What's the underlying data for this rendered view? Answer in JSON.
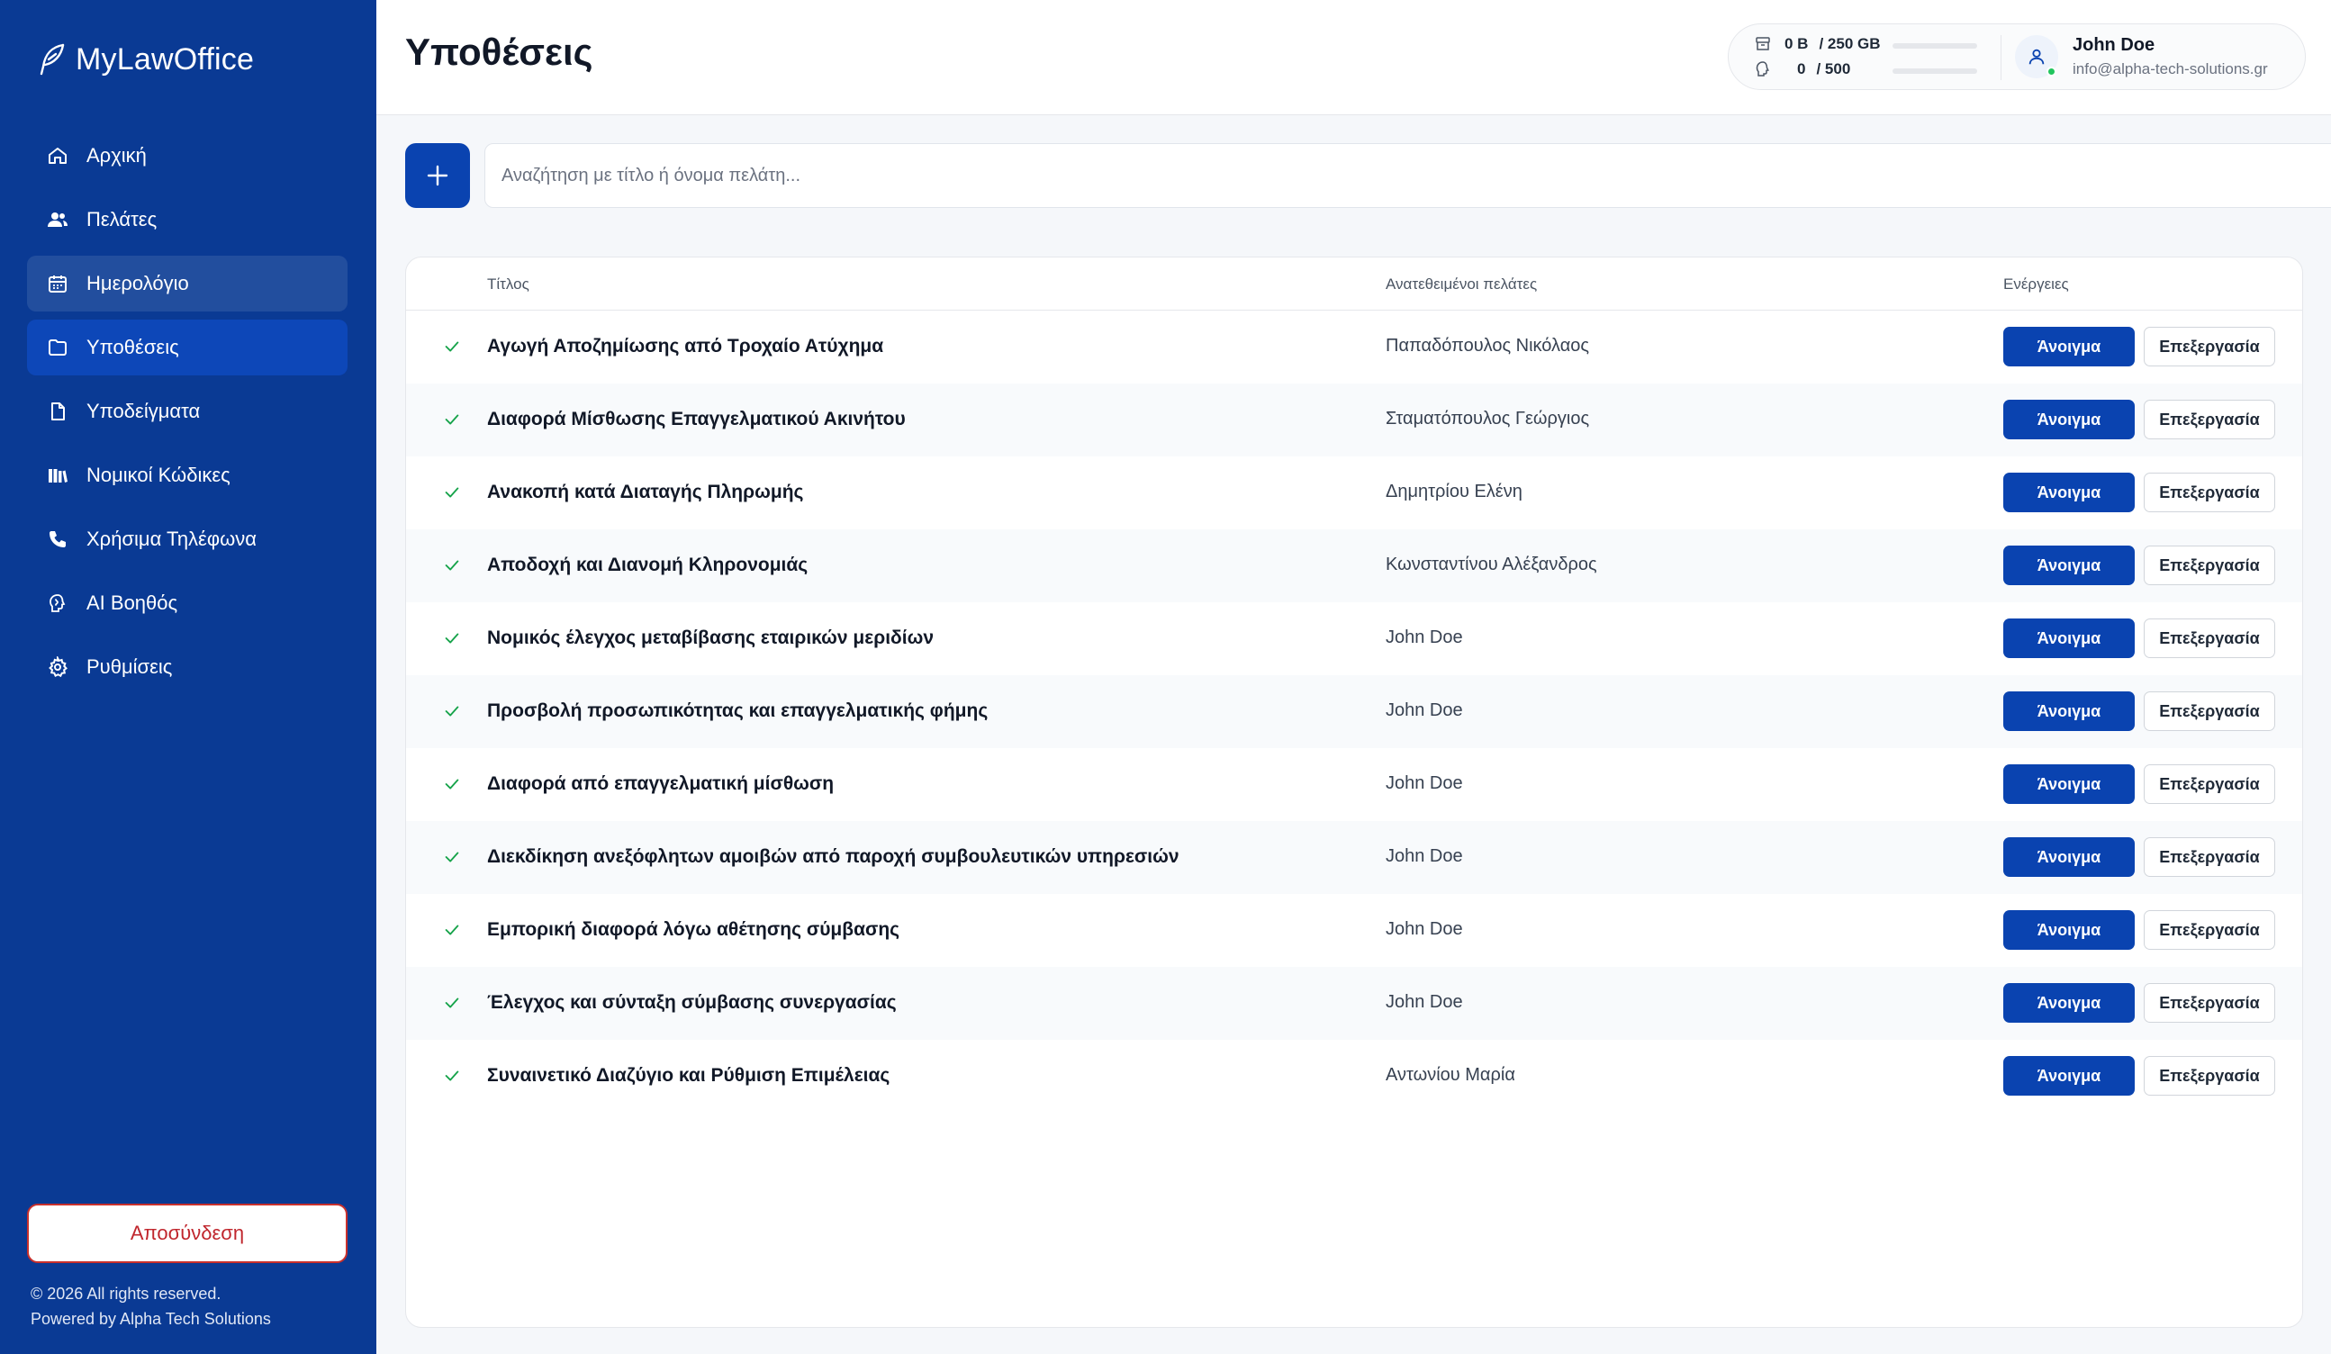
{
  "app": {
    "logo_text": "MyLawOffice"
  },
  "sidebar": {
    "items": [
      {
        "label": "Αρχική",
        "icon": "home-icon"
      },
      {
        "label": "Πελάτες",
        "icon": "users-icon"
      },
      {
        "label": "Ημερολόγιο",
        "icon": "calendar-icon"
      },
      {
        "label": "Υποθέσεις",
        "icon": "folder-icon"
      },
      {
        "label": "Υποδείγματα",
        "icon": "file-icon"
      },
      {
        "label": "Νομικοί Κώδικες",
        "icon": "library-icon"
      },
      {
        "label": "Χρήσιμα Τηλέφωνα",
        "icon": "phone-icon"
      },
      {
        "label": "AI Βοηθός",
        "icon": "brain-icon"
      },
      {
        "label": "Ρυθμίσεις",
        "icon": "gear-icon"
      }
    ],
    "active_item": "Υποθέσεις",
    "hover_item": "Ημερολόγιο",
    "logout_label": "Αποσύνδεση",
    "copyright": "© 2026 All rights reserved.",
    "powered_by": "Powered by Alpha Tech Solutions"
  },
  "header": {
    "title": "Υποθέσεις",
    "storage_used": "0 B",
    "storage_total": "/ 250 GB",
    "ai_used": "0",
    "ai_total": "/ 500",
    "user_name": "John Doe",
    "user_email": "info@alpha-tech-solutions.gr"
  },
  "search": {
    "placeholder": "Αναζήτηση με τίτλο ή όνομα πελάτη..."
  },
  "table": {
    "columns": {
      "title": "Τίτλος",
      "clients": "Ανατεθειμένοι πελάτες",
      "actions": "Ενέργειες"
    },
    "open_label": "Άνοιγμα",
    "edit_label": "Επεξεργασία",
    "rows": [
      {
        "title": "Αγωγή Αποζημίωσης από Τροχαίο Ατύχημα",
        "client": "Παπαδόπουλος Νικόλαος"
      },
      {
        "title": "Διαφορά Μίσθωσης Επαγγελματικού Ακινήτου",
        "client": "Σταματόπουλος Γεώργιος"
      },
      {
        "title": "Ανακοπή κατά Διαταγής Πληρωμής",
        "client": "Δημητρίου Ελένη"
      },
      {
        "title": "Αποδοχή και Διανομή Κληρονομιάς",
        "client": "Κωνσταντίνου Αλέξανδρος"
      },
      {
        "title": "Νομικός έλεγχος μεταβίβασης εταιρικών μεριδίων",
        "client": "John Doe"
      },
      {
        "title": "Προσβολή προσωπικότητας και επαγγελματικής φήμης",
        "client": "John Doe"
      },
      {
        "title": "Διαφορά από επαγγελματική μίσθωση",
        "client": "John Doe"
      },
      {
        "title": "Διεκδίκηση ανεξόφλητων αμοιβών από παροχή συμβουλευτικών υπηρεσιών",
        "client": "John Doe"
      },
      {
        "title": "Εμπορική διαφορά λόγω αθέτησης σύμβασης",
        "client": "John Doe"
      },
      {
        "title": "Έλεγχος και σύνταξη σύμβασης συνεργασίας",
        "client": "John Doe"
      },
      {
        "title": "Συναινετικό Διαζύγιο και Ρύθμιση Επιμέλειας",
        "client": "Αντωνίου Μαρία"
      }
    ]
  },
  "colors": {
    "sidebar": "#0a3a94",
    "primary": "#0a43b0",
    "logout": "#c0262d",
    "check": "#16a34a"
  }
}
